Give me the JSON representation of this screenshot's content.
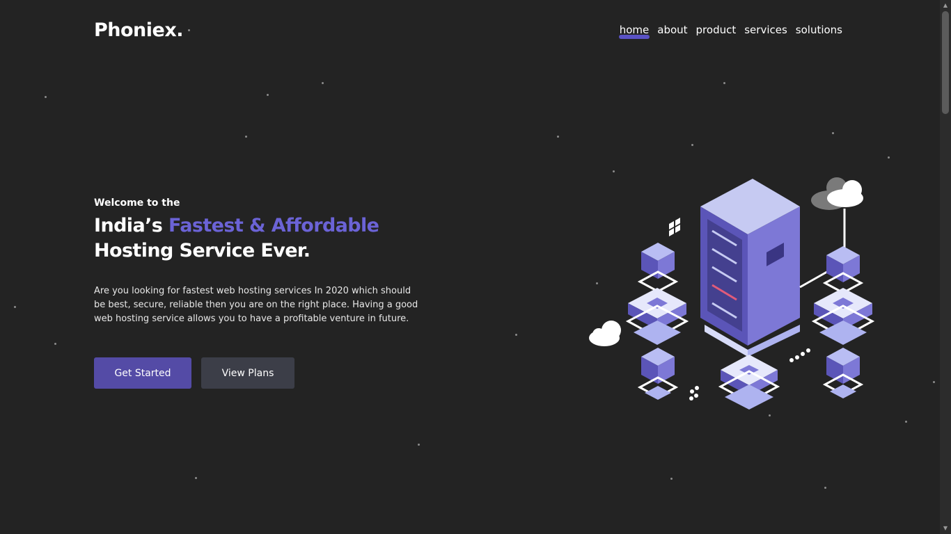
{
  "brand": {
    "logo": "Phoniex."
  },
  "nav": {
    "items": [
      {
        "label": "home",
        "active": true
      },
      {
        "label": "about"
      },
      {
        "label": "product"
      },
      {
        "label": "services"
      },
      {
        "label": "solutions"
      }
    ]
  },
  "hero": {
    "welcome": "Welcome to the",
    "headline_prefix": "India’s ",
    "headline_accent": "Fastest & Affordable",
    "headline_line2": "Hosting Service Ever.",
    "description": "Are you looking for fastest web hosting services In 2020 which should be best, secure, reliable then you are on the right place. Having a good web hosting service allows you to have a profitable venture in future.",
    "primary_button": "Get Started",
    "secondary_button": "View Plans"
  },
  "colors": {
    "background": "#232323",
    "accent": "#6b63d6",
    "primary_button": "#544ba6",
    "secondary_button": "#3c3e48"
  },
  "icons": {
    "scroll_up": "scroll-up-arrow-icon",
    "scroll_down": "scroll-down-arrow-icon"
  }
}
